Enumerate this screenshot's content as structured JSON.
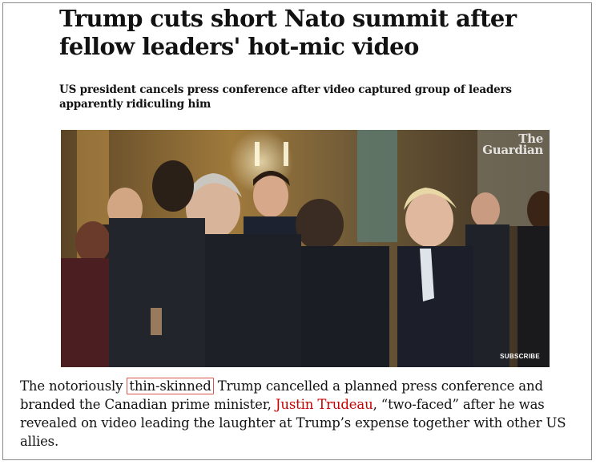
{
  "article": {
    "headline": "Trump cuts short Nato summit after fellow leaders' hot-mic video",
    "standfirst": "US president cancels press conference after video captured group of leaders apparently ridiculing him",
    "image": {
      "brand_line1": "The",
      "brand_line2": "Guardian",
      "subscribe_label": "SUBSCRIBE"
    },
    "body": {
      "part1": "The notoriously ",
      "highlight": "thin-skinned",
      "part2": " Trump cancelled a planned press conference and branded the Canadian prime minister, ",
      "link_text": "Justin Trudeau",
      "part3": ", “two-faced” after he was revealed on video leading the laughter at Trump’s expense together with other US allies."
    }
  },
  "colors": {
    "text": "#121212",
    "link": "#c70000",
    "highlight_border": "#d9534f",
    "frame_border": "#8a8a8a"
  }
}
